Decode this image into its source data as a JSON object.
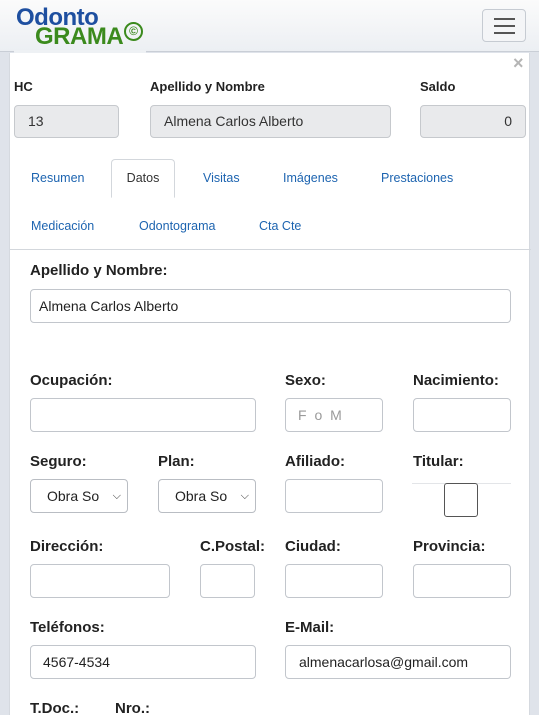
{
  "app": {
    "logo_top": "Odonto",
    "logo_bottom": "GRAMA",
    "logo_mark": "©"
  },
  "header": {
    "hc_label": "HC",
    "hc_value": "13",
    "name_label": "Apellido y Nombre",
    "name_value": "Almena Carlos Alberto",
    "saldo_label": "Saldo",
    "saldo_value": "0",
    "close": "×"
  },
  "tabs": [
    "Resumen",
    "Datos",
    "Visitas",
    "Imágenes",
    "Prestaciones",
    "Medicación",
    "Odontograma",
    "Cta Cte"
  ],
  "active_tab": "Datos",
  "form": {
    "nombre_label": "Apellido y Nombre:",
    "nombre_value": "Almena Carlos Alberto",
    "ocupacion_label": "Ocupación:",
    "ocupacion_value": "",
    "sexo_label": "Sexo:",
    "sexo_placeholder": "F o M",
    "nacimiento_label": "Nacimiento:",
    "nacimiento_value": "",
    "seguro_label": "Seguro:",
    "seguro_value": "Obra So",
    "plan_label": "Plan:",
    "plan_value": "Obra So",
    "afiliado_label": "Afiliado:",
    "afiliado_value": "",
    "titular_label": "Titular:",
    "titular_checked": false,
    "direccion_label": "Dirección:",
    "direccion_value": "",
    "cpostal_label": "C.Postal:",
    "cpostal_value": "",
    "ciudad_label": "Ciudad:",
    "ciudad_value": "",
    "provincia_label": "Provincia:",
    "provincia_value": "",
    "telefonos_label": "Teléfonos:",
    "telefonos_value": "4567-4534",
    "email_label": "E-Mail:",
    "email_value": "almenacarlosa@gmail.com",
    "tdoc_label": "T.Doc.:",
    "nro_label": "Nro.:"
  },
  "icons": {
    "select_chevron": "chevron-down-icon",
    "menu": "hamburger-menu-icon"
  },
  "colors": {
    "link": "#1d64b0",
    "logo_blue": "#1e4fa0",
    "logo_green": "#3b8a1d"
  }
}
